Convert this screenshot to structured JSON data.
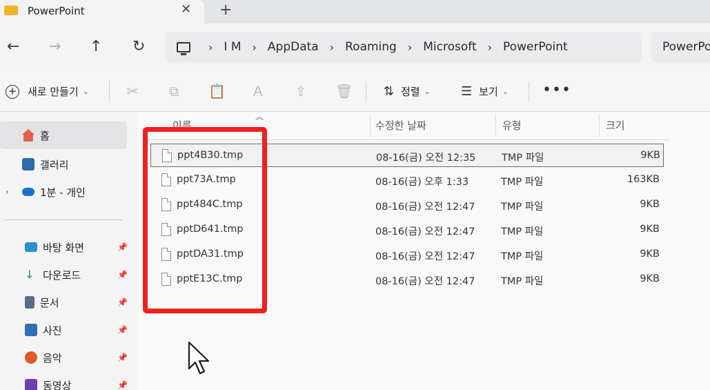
{
  "window": {
    "tab_title": "PowerPoint",
    "tab_close": "✕",
    "tab_new": "+"
  },
  "nav": {
    "back": "←",
    "forward": "→",
    "up": "↑",
    "refresh": "↻"
  },
  "breadcrumb": {
    "items": [
      "I M",
      "AppData",
      "Roaming",
      "Microsoft",
      "PowerPoint"
    ],
    "separator": "›"
  },
  "search": {
    "text": "PowerPoi"
  },
  "toolbar": {
    "new_label": "새로 만들기",
    "sort_label": "정렬",
    "view_label": "보기",
    "more_label": "•••"
  },
  "sidebar": {
    "items": [
      {
        "label": "홈",
        "icon": "home-icon"
      },
      {
        "label": "갤러리",
        "icon": "gallery-icon"
      },
      {
        "label": "1분 - 개인",
        "icon": "onedrive-icon"
      },
      {
        "label": "바탕 화면",
        "icon": "desktop-icon"
      },
      {
        "label": "다운로드",
        "icon": "download-icon"
      },
      {
        "label": "문서",
        "icon": "documents-icon"
      },
      {
        "label": "사진",
        "icon": "pictures-icon"
      },
      {
        "label": "음악",
        "icon": "music-icon"
      },
      {
        "label": "동영상",
        "icon": "videos-icon"
      }
    ]
  },
  "columns": {
    "name": "이름",
    "modified": "수정한 날짜",
    "type": "유형",
    "size": "크기"
  },
  "files": [
    {
      "name": "ppt4B30.tmp",
      "modified": "08-16(금) 오전 12:35",
      "type": "TMP 파일",
      "size": "9KB"
    },
    {
      "name": "ppt73A.tmp",
      "modified": "08-16(금) 오후 1:33",
      "type": "TMP 파일",
      "size": "163KB"
    },
    {
      "name": "ppt484C.tmp",
      "modified": "08-16(금) 오전 12:47",
      "type": "TMP 파일",
      "size": "9KB"
    },
    {
      "name": "pptD641.tmp",
      "modified": "08-16(금) 오전 12:47",
      "type": "TMP 파일",
      "size": "9KB"
    },
    {
      "name": "pptDA31.tmp",
      "modified": "08-16(금) 오전 12:47",
      "type": "TMP 파일",
      "size": "9KB"
    },
    {
      "name": "pptE13C.tmp",
      "modified": "08-16(금) 오전 12:47",
      "type": "TMP 파일",
      "size": "9KB"
    }
  ],
  "colors": {
    "highlight": "#f0201c",
    "folder": "#f0b429"
  }
}
